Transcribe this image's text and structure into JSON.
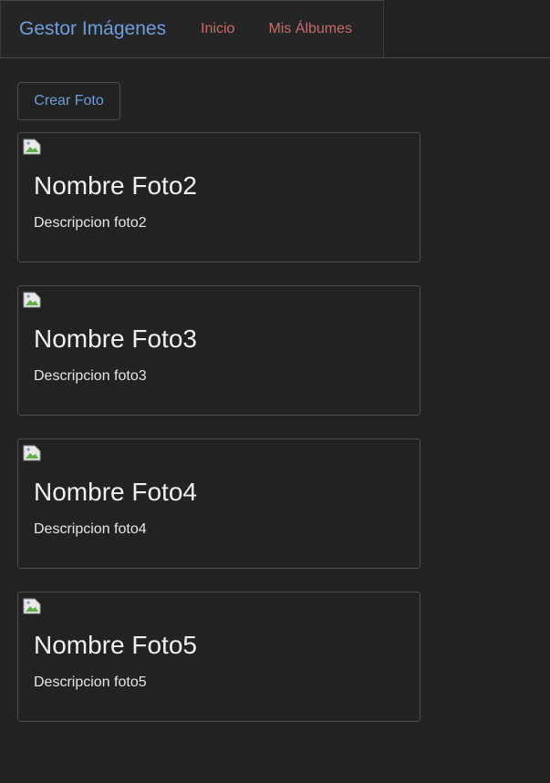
{
  "navbar": {
    "brand": "Gestor Imágenes",
    "links": [
      {
        "label": "Inicio"
      },
      {
        "label": "Mis Álbumes"
      }
    ]
  },
  "actions": {
    "create_label": "Crear Foto"
  },
  "photos": [
    {
      "title": "Nombre Foto2",
      "description": "Descripcion foto2",
      "image_icon": "broken-image-icon"
    },
    {
      "title": "Nombre Foto3",
      "description": "Descripcion foto3",
      "image_icon": "broken-image-icon"
    },
    {
      "title": "Nombre Foto4",
      "description": "Descripcion foto4",
      "image_icon": "broken-image-icon"
    },
    {
      "title": "Nombre Foto5",
      "description": "Descripcion foto5",
      "image_icon": "broken-image-icon"
    }
  ],
  "colors": {
    "background": "#222222",
    "brand": "#6d9edb",
    "nav_link": "#c86a6a",
    "border": "#4d4d4d",
    "text": "#f0f0f0"
  }
}
